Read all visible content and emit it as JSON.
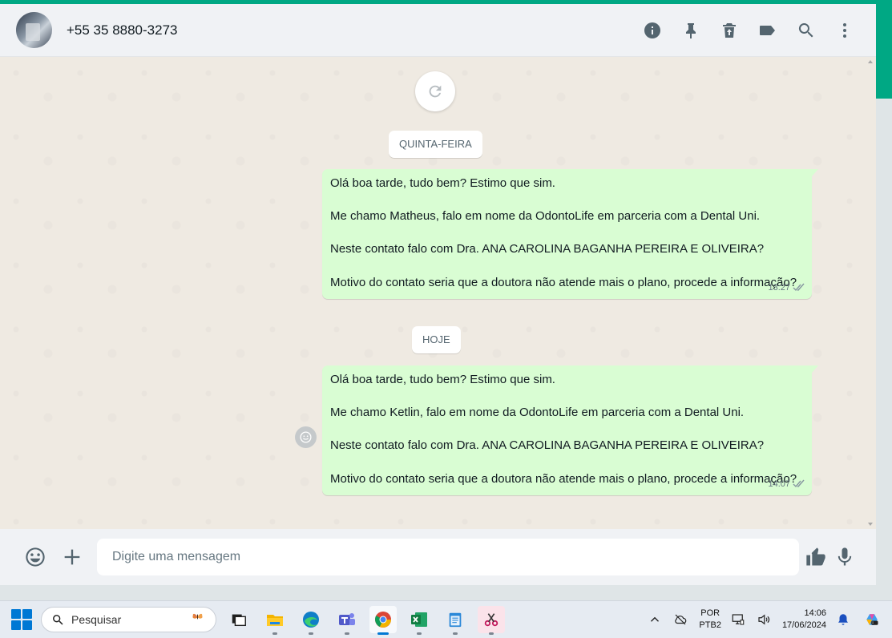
{
  "chat": {
    "contact_name": "+55 35 8880-3273"
  },
  "header_icons": [
    "info-icon",
    "pin-icon",
    "delete-icon",
    "label-icon",
    "search-icon",
    "menu-icon"
  ],
  "messages": {
    "day1": "QUINTA-FEIRA",
    "day2": "HOJE",
    "msg1": {
      "p1": "Olá boa tarde, tudo bem? Estimo que sim.",
      "p2": "Me chamo Matheus, falo em nome da OdontoLife em parceria com a Dental Uni.",
      "p3": "Neste contato falo com Dra. ANA CAROLINA BAGANHA PEREIRA E OLIVEIRA?",
      "p4": "Motivo do contato seria que a doutora não atende mais o plano, procede a informação?",
      "time": "13:27"
    },
    "msg2": {
      "p1": "Olá boa tarde, tudo bem? Estimo que sim.",
      "p2": "Me chamo Ketlin, falo em nome da OdontoLife em parceria com a Dental Uni.",
      "p3": "Neste contato falo com Dra. ANA CAROLINA BAGANHA PEREIRA E OLIVEIRA?",
      "p4": "Motivo do contato seria que a doutora não atende mais o plano, procede a informação?",
      "time": "14:07"
    }
  },
  "composer": {
    "placeholder": "Digite uma mensagem"
  },
  "taskbar": {
    "search_label": "Pesquisar",
    "apps": [
      "task-view",
      "file-explorer",
      "edge",
      "teams",
      "chrome",
      "excel",
      "notepad",
      "snipping-tool"
    ],
    "lang_line1": "POR",
    "lang_line2": "PTB2",
    "time": "14:06",
    "date": "17/06/2024"
  },
  "colors": {
    "accent": "#00a884",
    "outgoing_bubble": "#d9fdd3",
    "chat_bg": "#efeae2"
  }
}
